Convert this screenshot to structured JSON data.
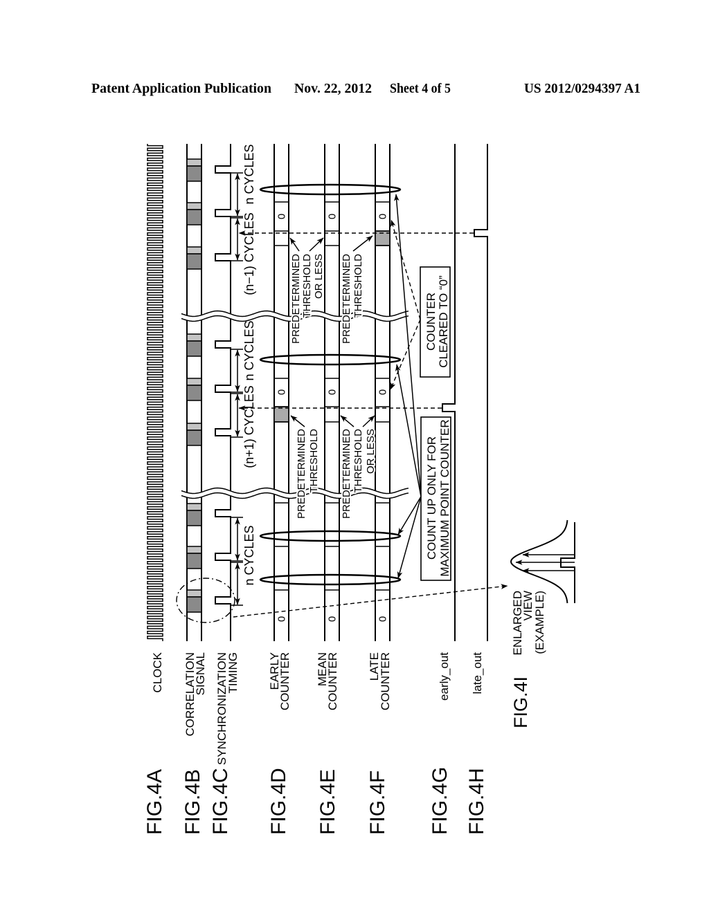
{
  "header": {
    "publication": "Patent Application Publication",
    "date": "Nov. 22, 2012",
    "sheet": "Sheet 4 of 5",
    "number": "US 2012/0294397 A1"
  },
  "figure_labels": {
    "a": "FIG.4A",
    "b": "FIG.4B",
    "c": "FIG.4C",
    "d": "FIG.4D",
    "e": "FIG.4E",
    "f": "FIG.4F",
    "g": "FIG.4G",
    "h": "FIG.4H",
    "i": "FIG.4I"
  },
  "signal_labels": {
    "clock": "CLOCK",
    "correlation": [
      "CORRELATION",
      "SIGNAL"
    ],
    "sync": [
      "SYNCHRONIZATION",
      "TIMING"
    ],
    "early": [
      "EARLY",
      "COUNTER"
    ],
    "mean": [
      "MEAN",
      "COUNTER"
    ],
    "late": [
      "LATE",
      "COUNTER"
    ],
    "early_out": "early_out",
    "late_out": "late_out"
  },
  "counter_value": "0",
  "timing_groups": [
    {
      "intervals": [
        "n CYCLES",
        "(n−1) CYCLES"
      ],
      "threshold_reached": "late",
      "threshold_or_less": [
        "early",
        "mean"
      ],
      "output_pulse": "late_out"
    },
    {
      "intervals": [
        "n CYCLES",
        "(n+1) CYCLES"
      ],
      "threshold_reached": "early",
      "threshold_or_less": [
        "mean",
        "late"
      ],
      "output_pulse": "early_out"
    },
    {
      "intervals": [
        "n CYCLES",
        "n CYCLES"
      ],
      "threshold_reached": null,
      "threshold_or_less": [],
      "output_pulse": null
    }
  ],
  "threshold_labels": {
    "threshold": [
      "PREDETERMINED",
      "THRESHOLD"
    ],
    "threshold_or_less": [
      "PREDETERMINED",
      "THRESHOLD",
      "OR LESS"
    ]
  },
  "callouts": {
    "cleared": [
      "COUNTER",
      "CLEARED TO “0”"
    ],
    "count_up": [
      "COUNT UP ONLY FOR",
      "MAXIMUM POINT COUNTER"
    ]
  },
  "enlarged_view": [
    "ENLARGED",
    "VIEW",
    "(EXAMPLE)"
  ]
}
